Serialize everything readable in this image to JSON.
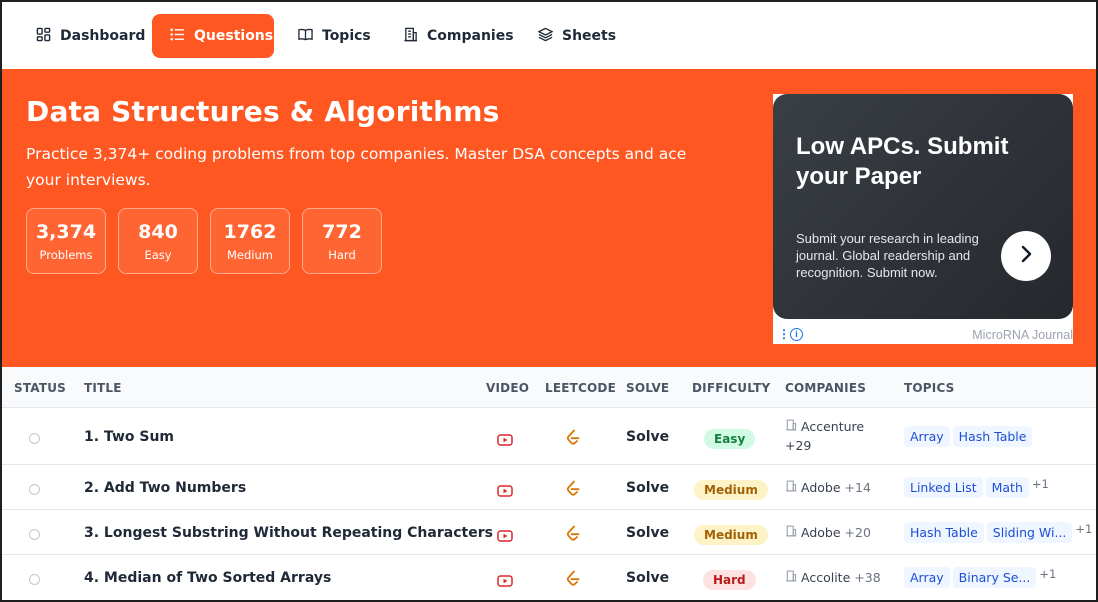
{
  "nav": {
    "items": [
      {
        "label": "Dashboard",
        "icon": "dashboard-icon",
        "active": false
      },
      {
        "label": "Questions",
        "icon": "list-icon",
        "active": true
      },
      {
        "label": "Topics",
        "icon": "book-icon",
        "active": false
      },
      {
        "label": "Companies",
        "icon": "building-icon",
        "active": false
      },
      {
        "label": "Sheets",
        "icon": "layers-icon",
        "active": false
      }
    ]
  },
  "hero": {
    "title": "Data Structures & Algorithms",
    "subtitle": "Practice 3,374+ coding problems from top companies. Master DSA concepts and ace your interviews.",
    "stats": [
      {
        "value": "3,374",
        "label": "Problems"
      },
      {
        "value": "840",
        "label": "Easy"
      },
      {
        "value": "1762",
        "label": "Medium"
      },
      {
        "value": "772",
        "label": "Hard"
      }
    ]
  },
  "ad": {
    "title": "Low APCs. Submit your Paper",
    "text": "Submit your research in leading journal. Global readership and recognition. Submit now.",
    "brand": "MicroRNA Journal"
  },
  "table": {
    "headers": {
      "status": "STATUS",
      "title": "TITLE",
      "video": "VIDEO",
      "leetcode": "LEETCODE",
      "solve": "SOLVE",
      "difficulty": "DIFFICULTY",
      "companies": "COMPANIES",
      "topics": "TOPICS"
    },
    "rows": [
      {
        "title": "1. Two Sum",
        "solve": "Solve",
        "difficulty": "Easy",
        "company": "Accenture",
        "company_more": "+29",
        "topics": [
          "Array",
          "Hash Table"
        ],
        "topics_more": ""
      },
      {
        "title": "2. Add Two Numbers",
        "solve": "Solve",
        "difficulty": "Medium",
        "company": "Adobe",
        "company_more": "+14",
        "topics": [
          "Linked List",
          "Math"
        ],
        "topics_more": "+1"
      },
      {
        "title": "3. Longest Substring Without Repeating Characters",
        "solve": "Solve",
        "difficulty": "Medium",
        "company": "Adobe",
        "company_more": "+20",
        "topics": [
          "Hash Table",
          "Sliding Wi..."
        ],
        "topics_more": "+1"
      },
      {
        "title": "4. Median of Two Sorted Arrays",
        "solve": "Solve",
        "difficulty": "Hard",
        "company": "Accolite",
        "company_more": "+38",
        "topics": [
          "Array",
          "Binary Se..."
        ],
        "topics_more": "+1"
      }
    ]
  },
  "colors": {
    "brand": "#ff5722",
    "easy": "#15803d",
    "medium": "#a16207",
    "hard": "#b91c1c",
    "video": "#dc2626",
    "leetcode": "#d97706"
  }
}
